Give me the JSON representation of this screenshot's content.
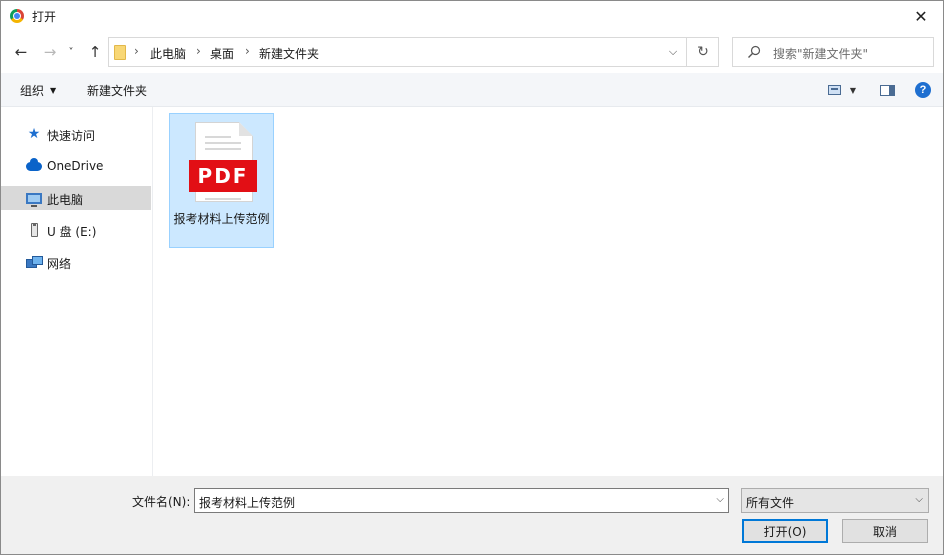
{
  "window": {
    "title": "打开",
    "close_glyph": "✕"
  },
  "nav": {
    "back_glyph": "←",
    "forward_glyph": "→",
    "recent_glyph": "˅",
    "up_glyph": "↑",
    "breadcrumbs": [
      "此电脑",
      "桌面",
      "新建文件夹"
    ],
    "separator": "›",
    "dropdown_glyph": "⌵",
    "refresh_glyph": "↻"
  },
  "search": {
    "placeholder": "搜索\"新建文件夹\""
  },
  "toolbar": {
    "organize": "组织",
    "new_folder": "新建文件夹",
    "help_glyph": "?"
  },
  "sidebar": {
    "items": [
      {
        "label": "快速访问",
        "icon": "star-icon"
      },
      {
        "label": "OneDrive",
        "icon": "cloud-icon"
      },
      {
        "label": "此电脑",
        "icon": "pc-icon",
        "selected": true
      },
      {
        "label": "U 盘 (E:)",
        "icon": "usb-drive-icon"
      },
      {
        "label": "网络",
        "icon": "network-icon"
      }
    ]
  },
  "files": [
    {
      "name": "报考材料上传范例",
      "badge": "PDF",
      "icon": "pdf-file-icon",
      "selected": true
    }
  ],
  "footer": {
    "filename_label": "文件名(N):",
    "filename_value": "报考材料上传范例",
    "filetype_value": "所有文件",
    "open_button": "打开(O)",
    "cancel_button": "取消",
    "caret_glyph": "⌵"
  },
  "colors": {
    "accent": "#0078d7",
    "selection": "#cce8ff",
    "pdf_red": "#e20f15"
  }
}
